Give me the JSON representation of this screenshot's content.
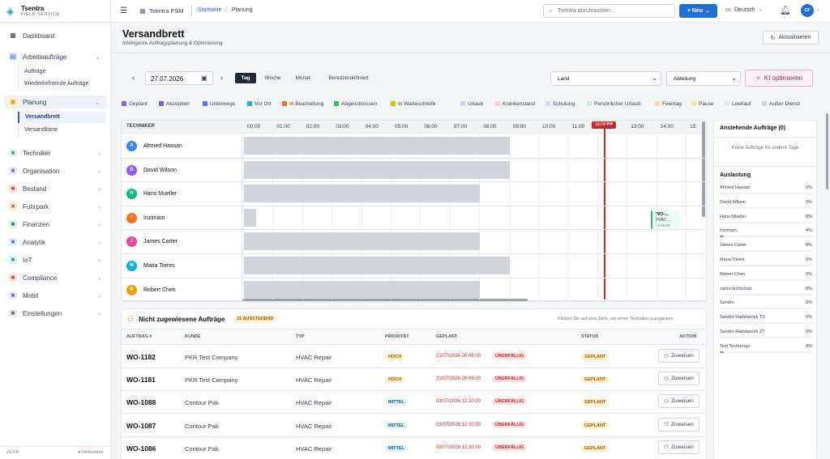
{
  "app": {
    "name": "Tsentra",
    "subtitle": "FIELD SERVICE",
    "version": "v1.0.0",
    "connection": "Verbunden"
  },
  "sidebar": {
    "dashboard": "Dashboard",
    "items": [
      {
        "label": "Arbeitsaufträge",
        "icon": "clipboard-icon",
        "color": "#3b82f6"
      },
      {
        "label": "Planung",
        "icon": "calendar-icon",
        "color": "#f59e0b"
      },
      {
        "label": "Techniker",
        "icon": "users-icon",
        "color": "#22c55e"
      },
      {
        "label": "Organisation",
        "icon": "building-icon",
        "color": "#8b5cf6"
      },
      {
        "label": "Bestand",
        "icon": "box-icon",
        "color": "#ef4444"
      },
      {
        "label": "Fuhrpark",
        "icon": "truck-icon",
        "color": "#f97316"
      },
      {
        "label": "Finanzen",
        "icon": "dollar-icon",
        "color": "#16a34a"
      },
      {
        "label": "Analytik",
        "icon": "chart-icon",
        "color": "#3b82f6"
      },
      {
        "label": "IoT",
        "icon": "wifi-icon",
        "color": "#06b6d4"
      },
      {
        "label": "Compliance",
        "icon": "shield-icon",
        "color": "#ef4444"
      },
      {
        "label": "Mobil",
        "icon": "phone-icon",
        "color": "#8b5cf6"
      },
      {
        "label": "Einstellungen",
        "icon": "gear-icon",
        "color": "#6b7280"
      }
    ],
    "sub_work": [
      "Aufträge",
      "Wiederkehrende Aufträge"
    ],
    "sub_plan": [
      "Versandbrett",
      "Versandkarte"
    ]
  },
  "topbar": {
    "org": "Tsentra FSM",
    "crumb1": "Startseite",
    "crumb2": "Planung",
    "search_placeholder": "Tsentra durchsuchen...",
    "new_label": "+ Neu",
    "lang_code": "DE",
    "lang": "Deutsch",
    "user_initials": "CF"
  },
  "page": {
    "title": "Versandbrett",
    "subtitle": "Intelligente Auftragsplanung & Optimierung",
    "refresh": "Aktualisieren"
  },
  "controls": {
    "date": "27.07.2026",
    "views": [
      "Tag",
      "Woche",
      "Monat",
      "Benutzerdefiniert"
    ],
    "active_view": "Tag",
    "country": "Land",
    "department": "Abteilung",
    "ai": "KI optimieren"
  },
  "legend": [
    {
      "label": "Geplant",
      "color": "#8b5cf6"
    },
    {
      "label": "Akzeptiert",
      "color": "#6366f1"
    },
    {
      "label": "Unterwegs",
      "color": "#3b82f6"
    },
    {
      "label": "Vor Ort",
      "color": "#06b6d4"
    },
    {
      "label": "In Bearbeitung",
      "color": "#f97316"
    },
    {
      "label": "Abgeschlossen",
      "color": "#22c55e"
    },
    {
      "label": "In Warteschleife",
      "color": "#eab308"
    },
    {
      "label": "Urlaub",
      "color": "#c7d2fe"
    },
    {
      "label": "Krankenstand",
      "color": "#fecaca"
    },
    {
      "label": "Schulung",
      "color": "#ddd6fe"
    },
    {
      "label": "Persönlicher Urlaub",
      "color": "#bbf7d0"
    },
    {
      "label": "Feiertag",
      "color": "#fed7aa"
    },
    {
      "label": "Pause",
      "color": "#fde68a"
    },
    {
      "label": "Leerlauf",
      "color": "#e5e7eb"
    },
    {
      "label": "Außer Dienst",
      "color": "#d1d5db"
    }
  ],
  "timeline": {
    "header": "TECHNIKER",
    "hours": [
      "00:00",
      "01:00",
      "02:00",
      "03:00",
      "04:00",
      "05:00",
      "06:00",
      "07:00",
      "08:00",
      "09:00",
      "10:00",
      "11:00",
      "12:00",
      "13:00",
      "14:00",
      "15:"
    ],
    "now": "12:14 PM",
    "technicians": [
      {
        "name": "Ahmed Hassan",
        "initial": "A",
        "color": "#3b82f6",
        "busy_until_hours": 9
      },
      {
        "name": "David Wilson",
        "initial": "D",
        "color": "#8b5cf6",
        "busy_until_hours": 9
      },
      {
        "name": "Hans Mueller",
        "initial": "H",
        "color": "#10b981",
        "busy_until_hours": 8
      },
      {
        "name": "Inzimam",
        "initial": "I",
        "color": "#f97316",
        "busy_until_hours": 0.4
      },
      {
        "name": "James Carter",
        "initial": "J",
        "color": "#ec4899",
        "busy_until_hours": 8
      },
      {
        "name": "Maria Torres",
        "initial": "M",
        "color": "#06b6d4",
        "busy_until_hours": 9
      },
      {
        "name": "Robert Chen",
        "initial": "R",
        "color": "#f59e0b",
        "busy_until_hours": 8
      }
    ],
    "event": {
      "id": "WO-...",
      "type": "HVAC ...",
      "time": "12:45:00"
    }
  },
  "pending": {
    "title": "Anstehende Aufträge (0)",
    "empty": "Keine Aufträge für andere Tage"
  },
  "utilization": {
    "title": "Auslastung",
    "rows": [
      {
        "name": "Ahmed Hassan",
        "pct": "0%",
        "value": 0
      },
      {
        "name": "David Wilson",
        "pct": "0%",
        "value": 0
      },
      {
        "name": "Hans Mueller",
        "pct": "0%",
        "value": 0
      },
      {
        "name": "Inzimam",
        "pct": "4%",
        "value": 4
      },
      {
        "name": "James Carter",
        "pct": "0%",
        "value": 0
      },
      {
        "name": "Maria Torres",
        "pct": "0%",
        "value": 0
      },
      {
        "name": "Robert Chen",
        "pct": "0%",
        "value": 0
      },
      {
        "name": "sama technician",
        "pct": "0%",
        "value": 0
      },
      {
        "name": "Sandro",
        "pct": "0%",
        "value": 0
      },
      {
        "name": "Sandro Radziwolek TS",
        "pct": "0%",
        "value": 0
      },
      {
        "name": "Sandro Radziwolek ZT",
        "pct": "0%",
        "value": 0
      },
      {
        "name": "Test Technician",
        "pct": "4%",
        "value": 4
      }
    ]
  },
  "unassigned": {
    "title": "Nicht zugewiesene Aufträge",
    "badge": "31 AUSSTEHEND",
    "hint": "Klicken Sie auf eine Zeile, um einen Techniker zuzuweisen",
    "columns": [
      "AUFTRAG #",
      "KUNDE",
      "TYP",
      "PRIORITÄT",
      "GEPLANT",
      "STATUS",
      "AKTION"
    ],
    "rows": [
      {
        "id": "WO-1182",
        "customer": "PKR Test Company",
        "type": "HVAC Repair",
        "priority": "HOCH",
        "date": "21/07/2026 20:45:00",
        "overdue": "ÜBERFÄLLIG",
        "status": "GEPLANT",
        "action": "Zuweisen"
      },
      {
        "id": "WO-1181",
        "customer": "PKR Test Company",
        "type": "HVAC Repair",
        "priority": "HOCH",
        "date": "21/07/2026 20:45:00",
        "overdue": "ÜBERFÄLLIG",
        "status": "GEPLANT",
        "action": "Zuweisen"
      },
      {
        "id": "WO-1088",
        "customer": "Contour Pak",
        "type": "HVAC Repair",
        "priority": "MITTEL",
        "date": "03/07/2026 12:30:00",
        "overdue": "ÜBERFÄLLIG",
        "status": "GEPLANT",
        "action": "Zuweisen"
      },
      {
        "id": "WO-1087",
        "customer": "Contour Pak",
        "type": "HVAC Repair",
        "priority": "MITTEL",
        "date": "03/07/2026 12:30:00",
        "overdue": "ÜBERFÄLLIG",
        "status": "GEPLANT",
        "action": "Zuweisen"
      },
      {
        "id": "WO-1086",
        "customer": "Contour Pak",
        "type": "HVAC Repair",
        "priority": "MITTEL",
        "date": "03/07/2026 12:30:00",
        "overdue": "ÜBERFÄLLIG",
        "status": "GEPLANT",
        "action": "Zuweisen"
      }
    ]
  }
}
